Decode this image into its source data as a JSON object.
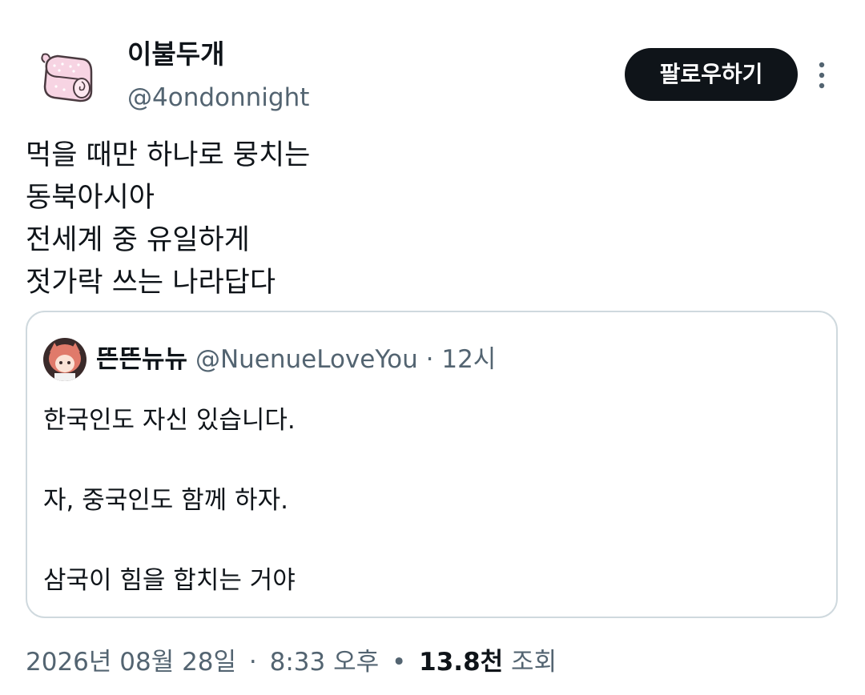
{
  "author": {
    "display_name": "이불두개",
    "handle": "@4ondonnight",
    "avatar_icon": "pink-bread-roll-avatar"
  },
  "follow_button": {
    "label": "팔로우하기"
  },
  "more_menu_icon": "more-vertical-icon",
  "tweet": {
    "lines": [
      "먹을 때만 하나로 뭉치는",
      "동북아시아",
      "전세계 중 유일하게",
      "젓가락 쓰는 나라답다"
    ]
  },
  "quoted_tweet": {
    "display_name": "뜬뜬뉴뉴",
    "handle": "@NuenueLoveYou",
    "separator": "·",
    "time": "12시",
    "avatar_icon": "anime-character-avatar",
    "lines": [
      "한국인도 자신 있습니다.",
      "",
      "자, 중국인도 함께 하자.",
      "",
      "삼국이 힘을 합치는 거야"
    ]
  },
  "footer": {
    "date": "2026년 08월 28일",
    "separator": "·",
    "time": "8:33 오후",
    "bullet": "•",
    "views_count": "13.8천",
    "views_label": "조회"
  },
  "colors": {
    "text_primary": "#0f1419",
    "text_secondary": "#536471",
    "border": "#cfd9de",
    "button_bg": "#0f1419",
    "button_text": "#ffffff"
  }
}
